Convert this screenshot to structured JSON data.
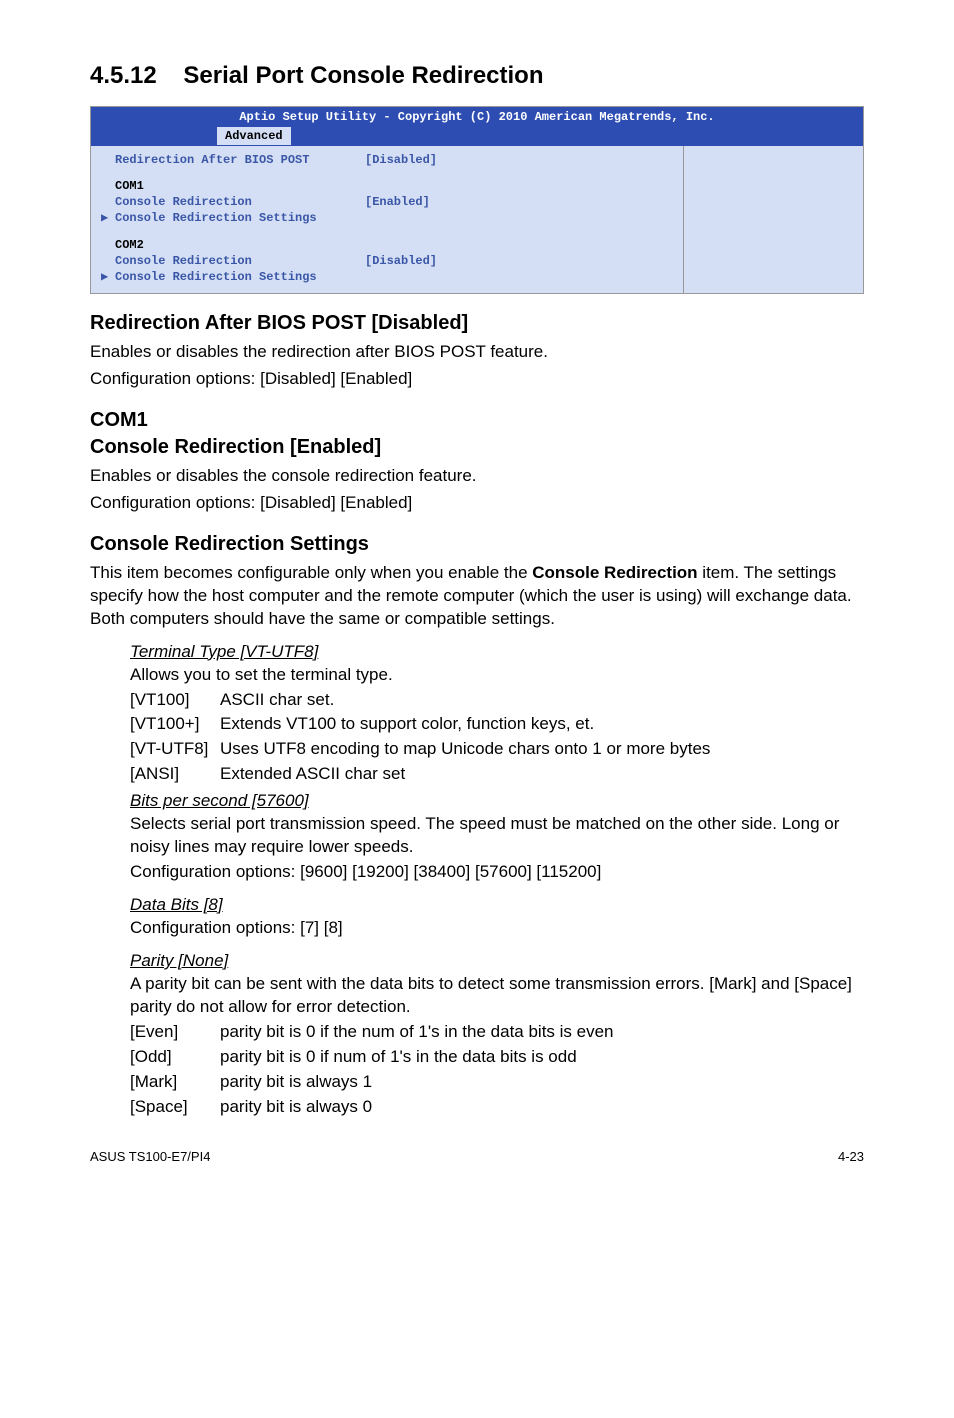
{
  "section": {
    "number": "4.5.12",
    "title": "Serial Port Console Redirection"
  },
  "bios": {
    "header_title": "Aptio Setup Utility - Copyright (C) 2010 American Megatrends, Inc.",
    "tab_active": "Advanced",
    "rows": {
      "r1_label": "Redirection After BIOS POST",
      "r1_value": "[Disabled]",
      "com1": "COM1",
      "c1_cr_label": "Console Redirection",
      "c1_cr_value": "[Enabled]",
      "c1_settings": "Console Redirection Settings",
      "com2": "COM2",
      "c2_cr_label": "Console Redirection",
      "c2_cr_value": "[Disabled]",
      "c2_settings": "Console Redirection Settings"
    },
    "arrow": "▶"
  },
  "headings": {
    "h1": "Redirection After BIOS POST [Disabled]",
    "h2a": "COM1",
    "h2b": "Console Redirection [Enabled]",
    "h3": "Console Redirection Settings"
  },
  "paras": {
    "p1a": "Enables or disables the redirection after BIOS POST feature.",
    "p1b": "Configuration options: [Disabled] [Enabled]",
    "p2a": "Enables or disables the console redirection feature.",
    "p2b": "Configuration options: [Disabled] [Enabled]",
    "p3": "This item becomes configurable only when you enable the ",
    "p3b": "Console Redirection",
    "p3c": " item. The settings specify how the host computer and the remote computer (which the user is using) will exchange data. Both computers should have the same or compatible settings."
  },
  "terminal": {
    "title": "Terminal Type [VT-UTF8]",
    "desc": "Allows you to set the terminal type.",
    "opts": [
      {
        "k": "[VT100]",
        "v": "ASCII char set."
      },
      {
        "k": "[VT100+]",
        "v": "Extends VT100 to support color, function keys, et."
      },
      {
        "k": "[VT-UTF8]",
        "v": "Uses UTF8 encoding to map Unicode chars onto 1 or more bytes"
      },
      {
        "k": "[ANSI]",
        "v": "Extended ASCII char set"
      }
    ]
  },
  "bits": {
    "title": "Bits per second [57600]",
    "desc1": "Selects serial port transmission speed. The speed must be matched on the other side. Long or noisy lines may require lower speeds.",
    "desc2": "Configuration options: [9600] [19200] [38400] [57600] [115200]"
  },
  "databits": {
    "title": "Data Bits [8]",
    "desc": "Configuration options: [7] [8]"
  },
  "parity": {
    "title": "Parity [None]",
    "desc": "A parity bit can be sent with the data bits to detect some transmission errors. [Mark] and [Space] parity do not allow for error detection.",
    "opts": [
      {
        "k": "[Even]",
        "v": "parity bit is 0 if the num of 1's in the data bits is even"
      },
      {
        "k": "[Odd]",
        "v": "parity bit is 0 if num of 1's in the data bits is odd"
      },
      {
        "k": "[Mark]",
        "v": "parity bit is always 1"
      },
      {
        "k": "[Space]",
        "v": "parity bit is always 0"
      }
    ]
  },
  "footer": {
    "left": "ASUS TS100-E7/PI4",
    "right": "4-23"
  }
}
